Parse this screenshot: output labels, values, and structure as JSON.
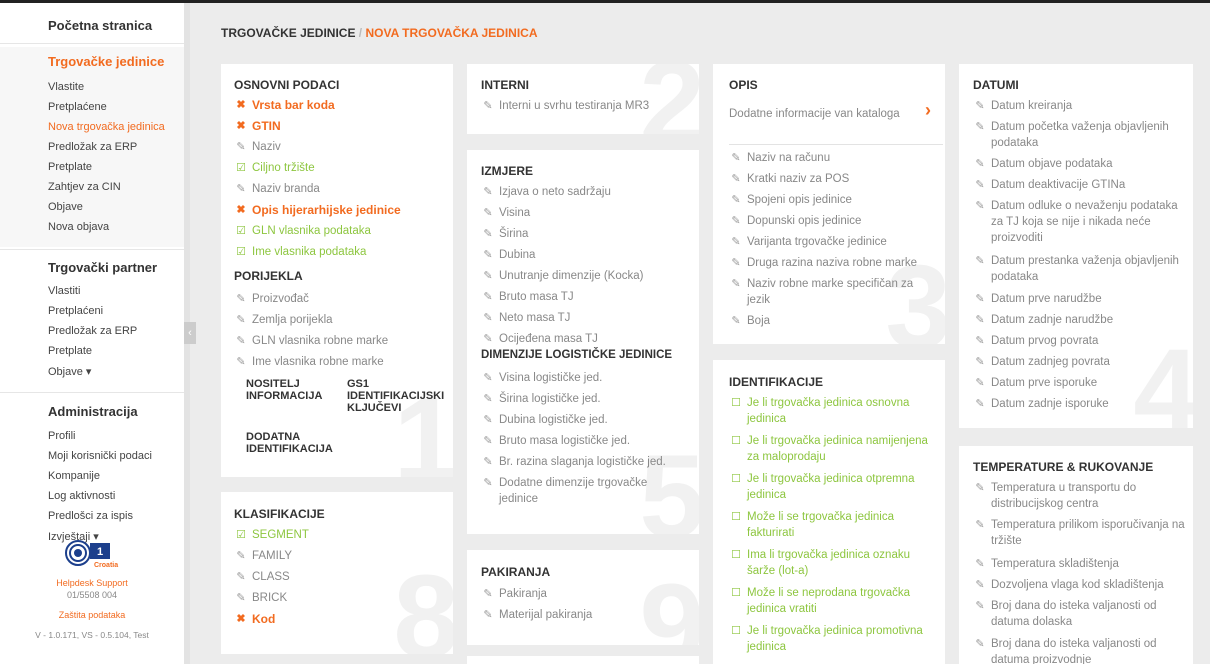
{
  "sidebar": {
    "home": "Početna stranica",
    "section1_title": "Trgovačke jedinice",
    "section1_items": [
      "Vlastite",
      "Pretplaćene",
      "Nova trgovačka jedinica",
      "Predložak za ERP",
      "Pretplate",
      "Zahtjev za CIN",
      "Objave",
      "Nova objava"
    ],
    "section2_title": "Trgovački partner",
    "section2_items": [
      "Vlastiti",
      "Pretplaćeni",
      "Predložak za ERP",
      "Pretplate",
      "Objave ▾"
    ],
    "section3_title": "Administracija",
    "section3_items": [
      "Profili",
      "Moji korisnički podaci",
      "Kompanije",
      "Log aktivnosti",
      "Predlošci za ispis",
      "Izvještaji ▾"
    ],
    "logo_text": "Croatia",
    "helpdesk_label": "Helpdesk Support",
    "helpdesk_phone": "01/5508 004",
    "privacy": "Zaštita podataka",
    "version": "V - 1.0.171, VS - 0.5.104, Test"
  },
  "breadcrumb": {
    "parent": "TRGOVAČKE JEDINICE",
    "separator": " / ",
    "current": "NOVA TRGOVAČKA JEDINICA"
  },
  "colors": {
    "accent": "#f26b20",
    "ok": "#8dc63f",
    "text": "#888888"
  },
  "cards": {
    "osnovni": {
      "title": "OSNOVNI PODACI",
      "items": [
        {
          "status": "error",
          "icon": "error-icon",
          "label": "Vrsta bar koda"
        },
        {
          "status": "error",
          "icon": "error-icon",
          "label": "GTIN"
        },
        {
          "status": "pending",
          "icon": "pencil-icon",
          "label": "Naziv"
        },
        {
          "status": "ok",
          "icon": "check-icon",
          "label": "Ciljno tržište"
        },
        {
          "status": "pending",
          "icon": "pencil-icon",
          "label": "Naziv branda"
        },
        {
          "status": "error",
          "icon": "error-icon",
          "label": "Opis hijerarhijske jedinice"
        },
        {
          "status": "ok",
          "icon": "check-icon",
          "label": "GLN vlasnika podataka"
        },
        {
          "status": "ok",
          "icon": "check-icon",
          "label": "Ime vlasnika podataka"
        }
      ],
      "sub_title": "PORIJEKLA",
      "sub_items": [
        "Proizvođač",
        "Zemlja porijekla",
        "GLN vlasnika robne marke",
        "Ime vlasnika robne marke"
      ],
      "extra_1": "NOSITELJ INFORMACIJA",
      "extra_2": "GS1 IDENTIFIKACIJSKI KLJUČEVI",
      "extra_3": "DODATNA IDENTIFIKACIJA",
      "number": "1"
    },
    "interni": {
      "title": "INTERNI",
      "items": [
        "Interni u svrhu testiranja MR3"
      ],
      "number": "2"
    },
    "izmjere": {
      "title": "IZMJERE",
      "items": [
        "Izjava o neto sadržaju",
        "Visina",
        "Širina",
        "Dubina",
        "Unutranje dimenzije (Kocka)",
        "Bruto masa TJ",
        "Neto masa TJ",
        "Ocijeđena masa TJ"
      ],
      "sub_title": "DIMENZIJE LOGISTIČKE JEDINICE",
      "sub_items": [
        "Visina logističke jed.",
        "Širina logističke jed.",
        "Dubina logističke jed.",
        "Bruto masa logističke jed.",
        "Br. razina slaganja logističke jed.",
        "Dodatne dimenzije trgovačke jedinice"
      ],
      "number": "5"
    },
    "opis": {
      "title": "OPIS",
      "link": "Dodatne informacije van kataloga",
      "items": [
        "Naziv na računu",
        "Kratki naziv za POS",
        "Spojeni opis jedinice",
        "Dopunski opis jedinice",
        "Varijanta trgovačke jedinice",
        "Druga razina naziva robne marke",
        "Naziv robne marke specifičan za jezik",
        "Boja"
      ],
      "number": "3"
    },
    "datumi": {
      "title": "DATUMI",
      "items": [
        "Datum kreiranja",
        "Datum početka važenja objavljenih podataka",
        "Datum objave podataka",
        "Datum deaktivacije GTINa",
        "Datum odluke o nevaženju podataka za TJ koja se nije i nikada neće proizvoditi",
        "Datum prestanka važenja objavljenih podataka",
        "Datum prve narudžbe",
        "Datum zadnje narudžbe",
        "Datum prvog povrata",
        "Datum zadnjeg povrata",
        "Datum prve isporuke",
        "Datum zadnje isporuke"
      ],
      "number": "4"
    },
    "identifikacije": {
      "title": "IDENTIFIKACIJE",
      "items": [
        "Je li trgovačka jedinica osnovna jedinica",
        "Je li trgovačka jedinica namijenjena za maloprodaju",
        "Je li trgovačka jedinica otpremna jedinica",
        "Može li se trgovačka jedinica fakturirati",
        "Ima li trgovačka jedinica oznaku šarže (lot-a)",
        "Može li se neprodana trgovačka jedinica vratiti",
        "Je li trgovačka jedinica promotivna jedinica"
      ]
    },
    "klasifikacije": {
      "title": "KLASIFIKACIJE",
      "items": [
        {
          "status": "ok",
          "icon": "check-icon",
          "label": "SEGMENT"
        },
        {
          "status": "pending",
          "icon": "pencil-icon",
          "label": "FAMILY"
        },
        {
          "status": "pending",
          "icon": "pencil-icon",
          "label": "CLASS"
        },
        {
          "status": "pending",
          "icon": "pencil-icon",
          "label": "BRICK"
        },
        {
          "status": "error",
          "icon": "error-icon",
          "label": "Kod"
        }
      ],
      "number": "8"
    },
    "pakiranja": {
      "title": "PAKIRANJA",
      "items": [
        "Pakiranja",
        "Materijal pakiranja"
      ],
      "number": "9"
    },
    "temperature": {
      "title": "TEMPERATURE & RUKOVANJE",
      "items": [
        "Temperatura u transportu do distribucijskog centra",
        "Temperatura prilikom isporučivanja na tržište",
        "Temperatura skladištenja",
        "Dozvoljena vlaga kod skladištenja",
        "Broj dana do isteka valjanosti od datuma dolaska",
        "Broj dana do isteka valjanosti od datuma proizvodnje"
      ]
    }
  }
}
